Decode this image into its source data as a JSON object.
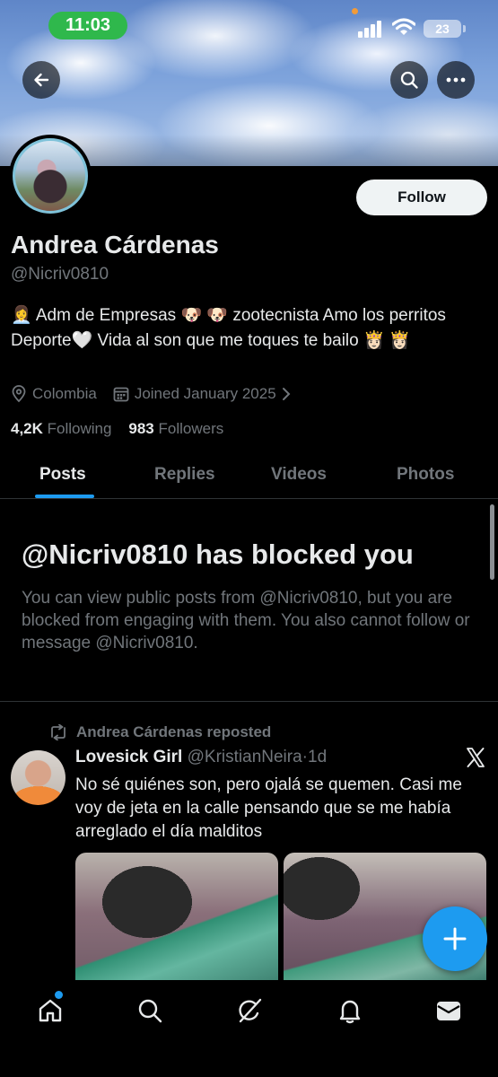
{
  "status_bar": {
    "time": "11:03",
    "battery": "23"
  },
  "profile": {
    "follow_label": "Follow",
    "name": "Andrea Cárdenas",
    "handle": "@Nicriv0810",
    "bio": "👩‍💼 Adm de Empresas 🐶 🐶 zootecnista Amo los perritos Deporte🤍 Vida al son que me toques te bailo 👸🏻 👸🏻",
    "location": "Colombia",
    "joined": "Joined January 2025",
    "following_count": "4,2K",
    "following_label": "Following",
    "followers_count": "983",
    "followers_label": "Followers"
  },
  "tabs": [
    "Posts",
    "Replies",
    "Videos",
    "Photos"
  ],
  "blocked": {
    "title": "@Nicriv0810 has blocked you",
    "text": "You can view public posts from @Nicriv0810, but you are blocked from engaging with them. You also cannot follow or message @Nicriv0810."
  },
  "post": {
    "repost_label": "Andrea Cárdenas reposted",
    "author": "Lovesick Girl",
    "handle": "@KristianNeira",
    "separator": "·",
    "time": "1d",
    "text": "No sé quiénes son, pero ojalá se quemen. Casi me voy de jeta en la calle pensando que se me había arreglado el día malditos"
  },
  "icons": {
    "back": "back-arrow-icon",
    "search": "search-icon",
    "more": "more-icon",
    "location": "location-pin-icon",
    "calendar": "calendar-icon",
    "repost": "repost-icon",
    "x_logo": "x-logo-icon",
    "compose": "compose-plus-icon",
    "nav_home": "home-icon",
    "nav_search": "search-icon",
    "nav_grok": "grok-icon",
    "nav_notifications": "bell-icon",
    "nav_messages": "mail-icon"
  },
  "colors": {
    "accent": "#1d9bf0",
    "time_pill": "#2fb84c",
    "muted": "#71767b"
  }
}
